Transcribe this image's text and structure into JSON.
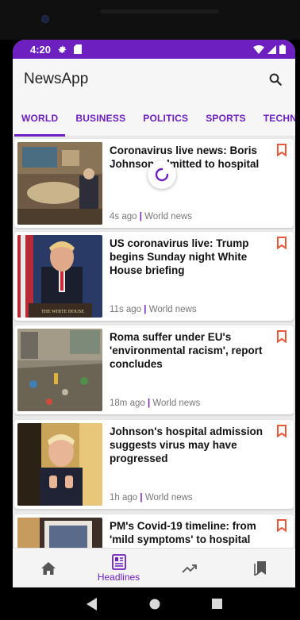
{
  "status_bar": {
    "time": "4:20",
    "battery_icon": "battery-icon",
    "colors": {
      "bar": "#6d1fc0"
    }
  },
  "app_bar": {
    "title": "NewsApp",
    "search_icon": "search-icon"
  },
  "tabs": [
    {
      "label": "WORLD",
      "active": true
    },
    {
      "label": "BUSINESS",
      "active": false
    },
    {
      "label": "POLITICS",
      "active": false
    },
    {
      "label": "SPORTS",
      "active": false
    },
    {
      "label": "TECHNOLOG",
      "active": false
    }
  ],
  "articles": [
    {
      "headline": "Coronavirus live news: Boris Johnson admitted to hospital",
      "time": "4s ago",
      "category": "World news"
    },
    {
      "headline": "US coronavirus live: Trump begins Sunday night White House briefing",
      "time": "11s ago",
      "category": "World news"
    },
    {
      "headline": "Roma suffer under EU's 'environmental racism', report concludes",
      "time": "18m ago",
      "category": "World news"
    },
    {
      "headline": "Johnson's hospital admission suggests virus may have progressed",
      "time": "1h ago",
      "category": "World news"
    },
    {
      "headline": "PM's Covid-19 timeline: from 'mild symptoms' to hospital",
      "time": "",
      "category": ""
    }
  ],
  "bottom_nav": [
    {
      "icon": "home-icon",
      "label": ""
    },
    {
      "icon": "headlines-icon",
      "label": "Headlines",
      "active": true
    },
    {
      "icon": "trending-icon",
      "label": ""
    },
    {
      "icon": "bookmarks-icon",
      "label": ""
    }
  ],
  "system_nav": [
    "back-icon",
    "home-circle-icon",
    "recents-icon"
  ],
  "accent_color": "#6d1fc0",
  "bookmark_color": "#e8593c"
}
